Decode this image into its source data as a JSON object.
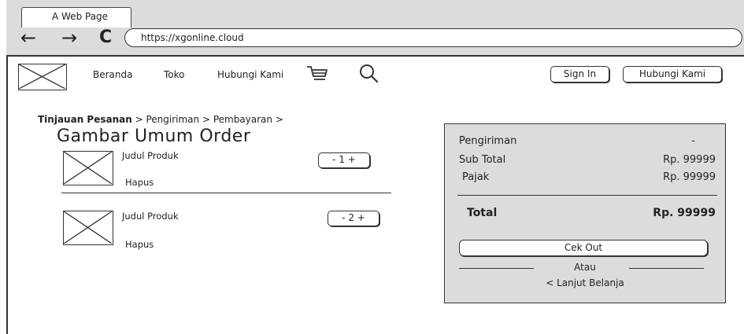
{
  "browser": {
    "tab_title": "A Web Page",
    "url": "https://xgonline.cloud",
    "back_glyph": "←",
    "forward_glyph": "→",
    "reload_glyph": "C"
  },
  "nav": {
    "links": [
      "Beranda",
      "Toko",
      "Hubungi Kami"
    ],
    "sign_in": "Sign In",
    "contact_button": "Hubungi Kami"
  },
  "breadcrumb": {
    "active": "Tinjauan Pesanan",
    "rest": " >  Pengiriman >  Pembayaran >",
    "sep": " > "
  },
  "page_title": "Gambar Umum Order",
  "products": [
    {
      "name": "Judul Produk",
      "stepper": "- 1 +",
      "remove": "Hapus"
    },
    {
      "name": "Judul Produk",
      "stepper": "- 2 +",
      "remove": "Hapus"
    }
  ],
  "summary": {
    "shipping_label": "Pengiriman",
    "shipping_value": "-",
    "subtotal_label": "Sub Total",
    "subtotal_value": "Rp. 99999",
    "tax_label": "Pajak",
    "tax_value": "Rp. 99999",
    "total_label": "Total",
    "total_value": "Rp. 99999",
    "checkout_label": "Cek Out",
    "or_label": "Atau",
    "continue_label": "< Lanjut Belanja"
  },
  "colors": {
    "panel_bg": "#dcdcdc",
    "stroke": "#333333"
  }
}
